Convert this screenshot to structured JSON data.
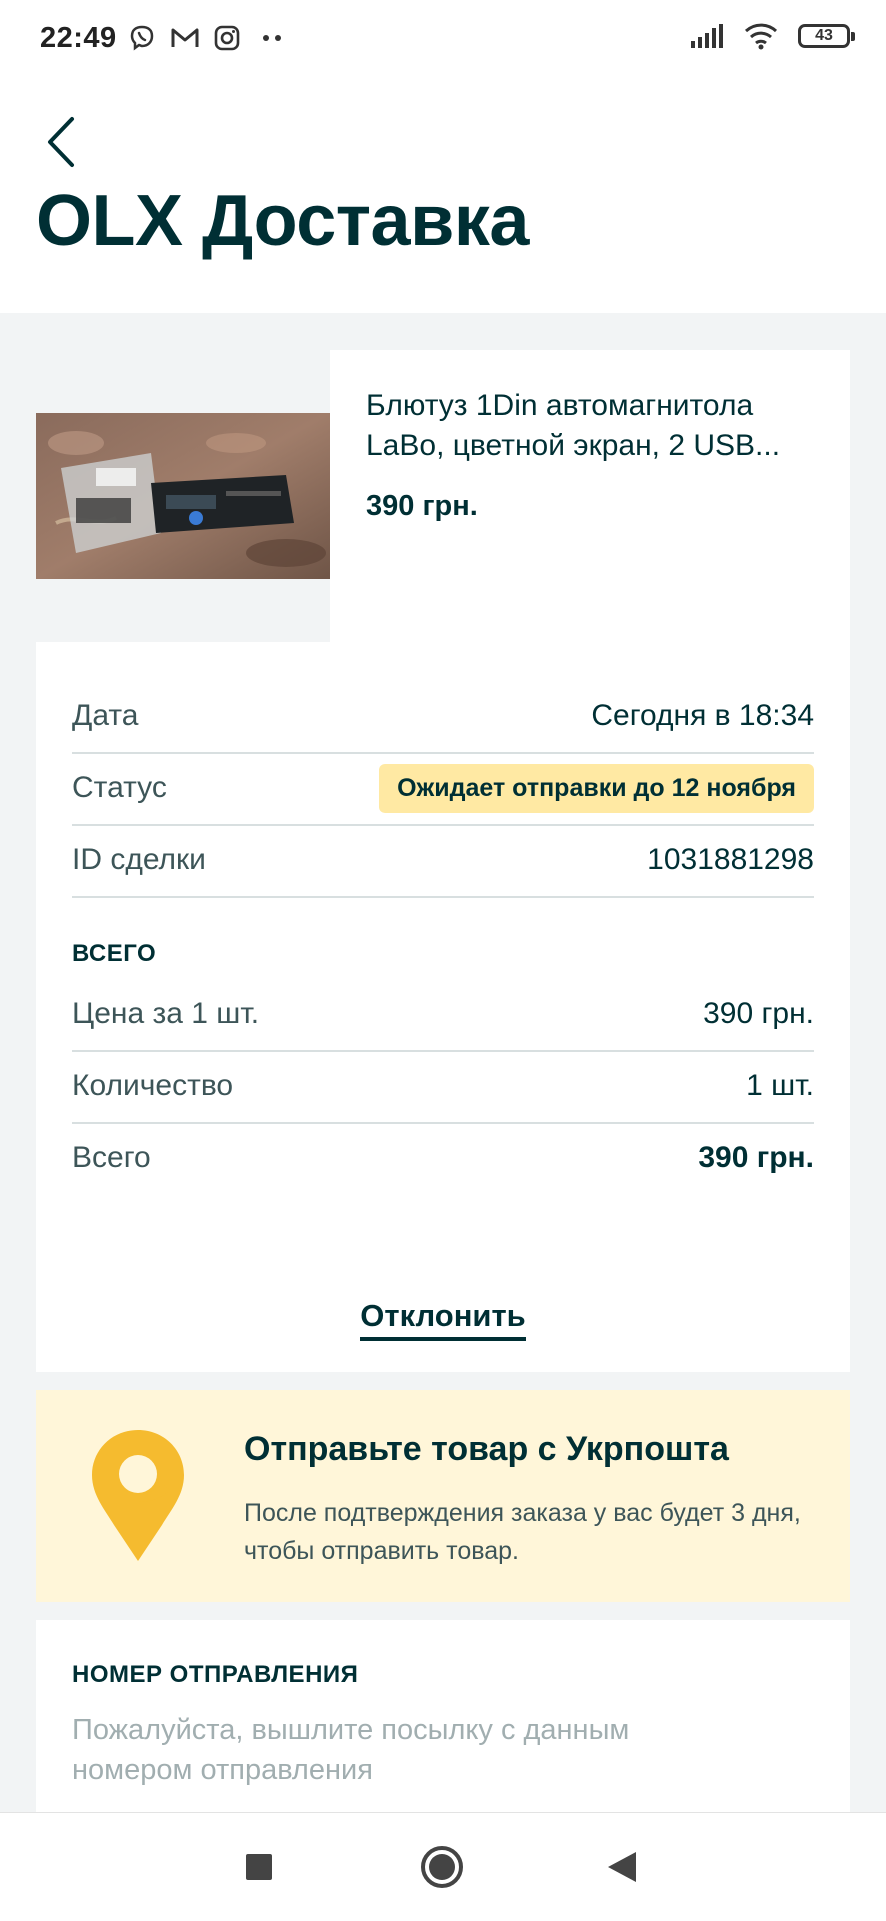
{
  "status_bar": {
    "time": "22:49",
    "left_icons": [
      "viber-icon",
      "gmail-icon",
      "instagram-icon",
      "more-dots-icon"
    ],
    "right_icons": [
      "signal-icon",
      "wifi-icon",
      "battery-icon"
    ],
    "battery": "43"
  },
  "header": {
    "back_icon": "chevron-left-icon",
    "title": "OLX Доставка"
  },
  "product": {
    "name": "Блютуз 1Din автомагнитола LaBo, цветной экран, 2 USB...",
    "price": "390 грн."
  },
  "details": {
    "date_label": "Дата",
    "date_value": "Сегодня в 18:34",
    "status_label": "Статус",
    "status_value": "Ожидает отправки до 12 ноября",
    "deal_id_label": "ID сделки",
    "deal_id_value": "1031881298"
  },
  "totals": {
    "heading": "ВСЕГО",
    "unit_price_label": "Цена за 1 шт.",
    "unit_price_value": "390 грн.",
    "quantity_label": "Количество",
    "quantity_value": "1 шт.",
    "total_label": "Всего",
    "total_value": "390 грн."
  },
  "actions": {
    "decline": "Отклонить"
  },
  "shipping_info": {
    "icon": "location-pin-icon",
    "title": "Отправьте товар с Укрпошта",
    "text": "После подтверждения заказа у вас будет 3 дня, чтобы отправить товар."
  },
  "tracking": {
    "heading": "НОМЕР ОТПРАВЛЕНИЯ",
    "text": "Пожалуйста, вышлите посылку с данным номером отправления"
  },
  "nav_bar": {
    "buttons": [
      "recents-square-icon",
      "home-circle-icon",
      "back-triangle-icon"
    ]
  },
  "colors": {
    "primary": "#002f34",
    "status_badge": "#ffe9a3",
    "info_bg": "#fff6d9",
    "pin": "#f5bb2f",
    "page_bg": "#f2f4f5"
  }
}
